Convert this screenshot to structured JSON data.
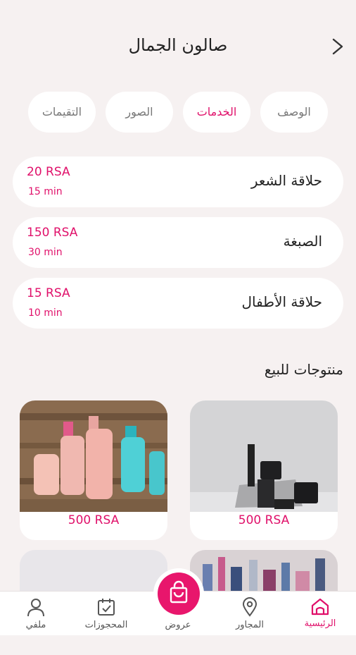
{
  "header": {
    "title": "صالون الجمال"
  },
  "tabs": [
    {
      "label": "الوصف",
      "active": false
    },
    {
      "label": "الخدمات",
      "active": true
    },
    {
      "label": "الصور",
      "active": false
    },
    {
      "label": "التقيمات",
      "active": false
    }
  ],
  "services": [
    {
      "name": "حلاقة الشعر",
      "price": "20 RSA",
      "duration": "15 min"
    },
    {
      "name": "الصبغة",
      "price": "150 RSA",
      "duration": "30 min"
    },
    {
      "name": "حلاقة الأطفال",
      "price": "15 RSA",
      "duration": "10 min"
    }
  ],
  "products_section": {
    "title": "منتوجات للبيع"
  },
  "products": [
    {
      "price": "500 RSA"
    },
    {
      "price": "500 RSA"
    }
  ],
  "nav": {
    "home": "الرئيسية",
    "nearby": "المجاور",
    "offers": "عروض",
    "bookings": "المحجوزات",
    "profile": "ملفي"
  },
  "colors": {
    "accent": "#e0106a",
    "background": "#f6f1f1"
  }
}
